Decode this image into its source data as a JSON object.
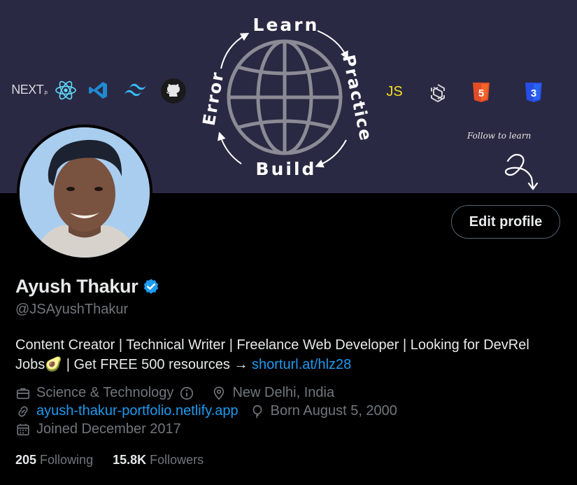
{
  "banner": {
    "tech_logos": [
      "NEXT.js",
      "react-icon",
      "vscode-icon",
      "tailwind-icon",
      "github-icon",
      "JS",
      "sanity-icon",
      "html5-icon",
      "css3-icon"
    ],
    "next_label": "NEXT",
    "next_suffix": ".js",
    "js_label": "JS",
    "html_label": "5",
    "css_label": "3",
    "cycle_words": [
      "Learn",
      "Practice",
      "Build",
      "Error"
    ],
    "follow_note": "Follow to learn"
  },
  "profile": {
    "display_name": "Ayush Thakur",
    "handle": "@JSAyushThakur",
    "edit_button": "Edit profile",
    "bio_text": "Content Creator | Technical Writer | Freelance Web Developer | Looking for DevRel Jobs🥑 | Get FREE 500 resources → ",
    "bio_link": "shorturl.at/hlz28",
    "category": "Science & Technology",
    "location": "New Delhi, India",
    "website": "ayush-thakur-portfolio.netlify.app",
    "birthday": "Born August 5, 2000",
    "joined": "Joined December 2017",
    "following_count": "205",
    "following_label": " Following",
    "followers_count": "15.8K",
    "followers_label": " Followers"
  },
  "colors": {
    "background": "#000000",
    "banner": "#2a2943",
    "accent": "#1d9bf0",
    "secondary_text": "#71767b",
    "primary_text": "#e7e9ea"
  }
}
